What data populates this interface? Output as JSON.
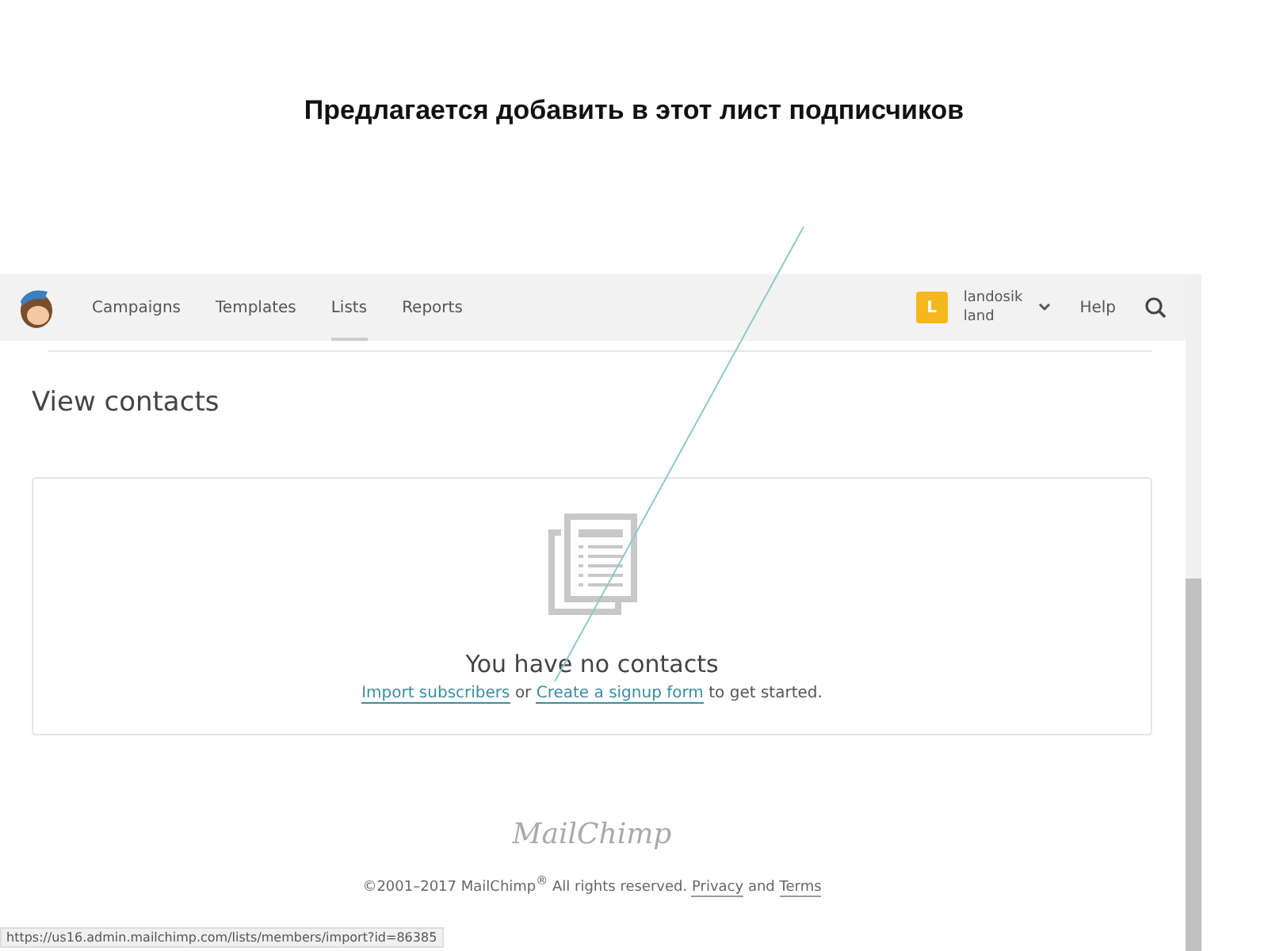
{
  "caption": "Предлагается добавить в этот лист подписчиков",
  "nav": {
    "items": [
      {
        "label": "Campaigns",
        "selected": false
      },
      {
        "label": "Templates",
        "selected": false
      },
      {
        "label": "Lists",
        "selected": true
      },
      {
        "label": "Reports",
        "selected": false
      }
    ],
    "account": {
      "initial": "L",
      "name": "landosik",
      "sub": "land"
    },
    "help": "Help"
  },
  "page_title": "View contacts",
  "empty_state": {
    "title": "You have no contacts",
    "import_link": "Import subscribers",
    "or": "or",
    "signup_link": "Create a signup form",
    "tail": "to get started."
  },
  "footer": {
    "logo": "MailChimp",
    "copyright": "©2001–2017 MailChimp$^{®}$ All rights reserved.",
    "privacy": "Privacy",
    "and": "and",
    "terms": "Terms"
  },
  "status_url": "https://us16.admin.mailchimp.com/lists/members/import?id=86385"
}
